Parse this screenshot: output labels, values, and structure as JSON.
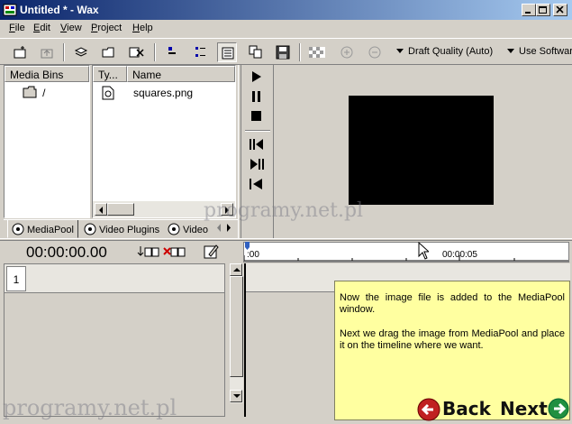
{
  "window": {
    "title": "Untitled * - Wax"
  },
  "menu": [
    {
      "label": "File",
      "mnemonic": "F"
    },
    {
      "label": "Edit",
      "mnemonic": "E"
    },
    {
      "label": "View",
      "mnemonic": "V"
    },
    {
      "label": "Project",
      "mnemonic": "P"
    },
    {
      "label": "Help",
      "mnemonic": "H"
    }
  ],
  "toolbar": {
    "quality_label": "Draft Quality (Auto)",
    "render_label": "Use Softwar"
  },
  "media_pool": {
    "columns": {
      "bins": "Media Bins",
      "type": "Ty...",
      "name": "Name"
    },
    "bin_root": "/",
    "files": [
      {
        "name": "squares.png"
      }
    ],
    "tabs": [
      "MediaPool",
      "Video Plugins",
      "Video"
    ]
  },
  "timeline": {
    "timecode": "00:00:00.00",
    "ruler_start": ":00",
    "ruler_mark": "00:00:05",
    "track_number": "1"
  },
  "tutorial": {
    "line1": "Now the image file is added to the MediaPool window.",
    "line2": "Next we drag the image from MediaPool and place it on the timeline where we want.",
    "back_label": "Back",
    "next_label": "Next"
  },
  "watermark": "programy.net.pl",
  "colors": {
    "titlebar_start": "#0a246a",
    "titlebar_end": "#a6caf0",
    "face": "#d4d0c8",
    "preview": "#000000",
    "tooltip": "#ffffa0"
  }
}
